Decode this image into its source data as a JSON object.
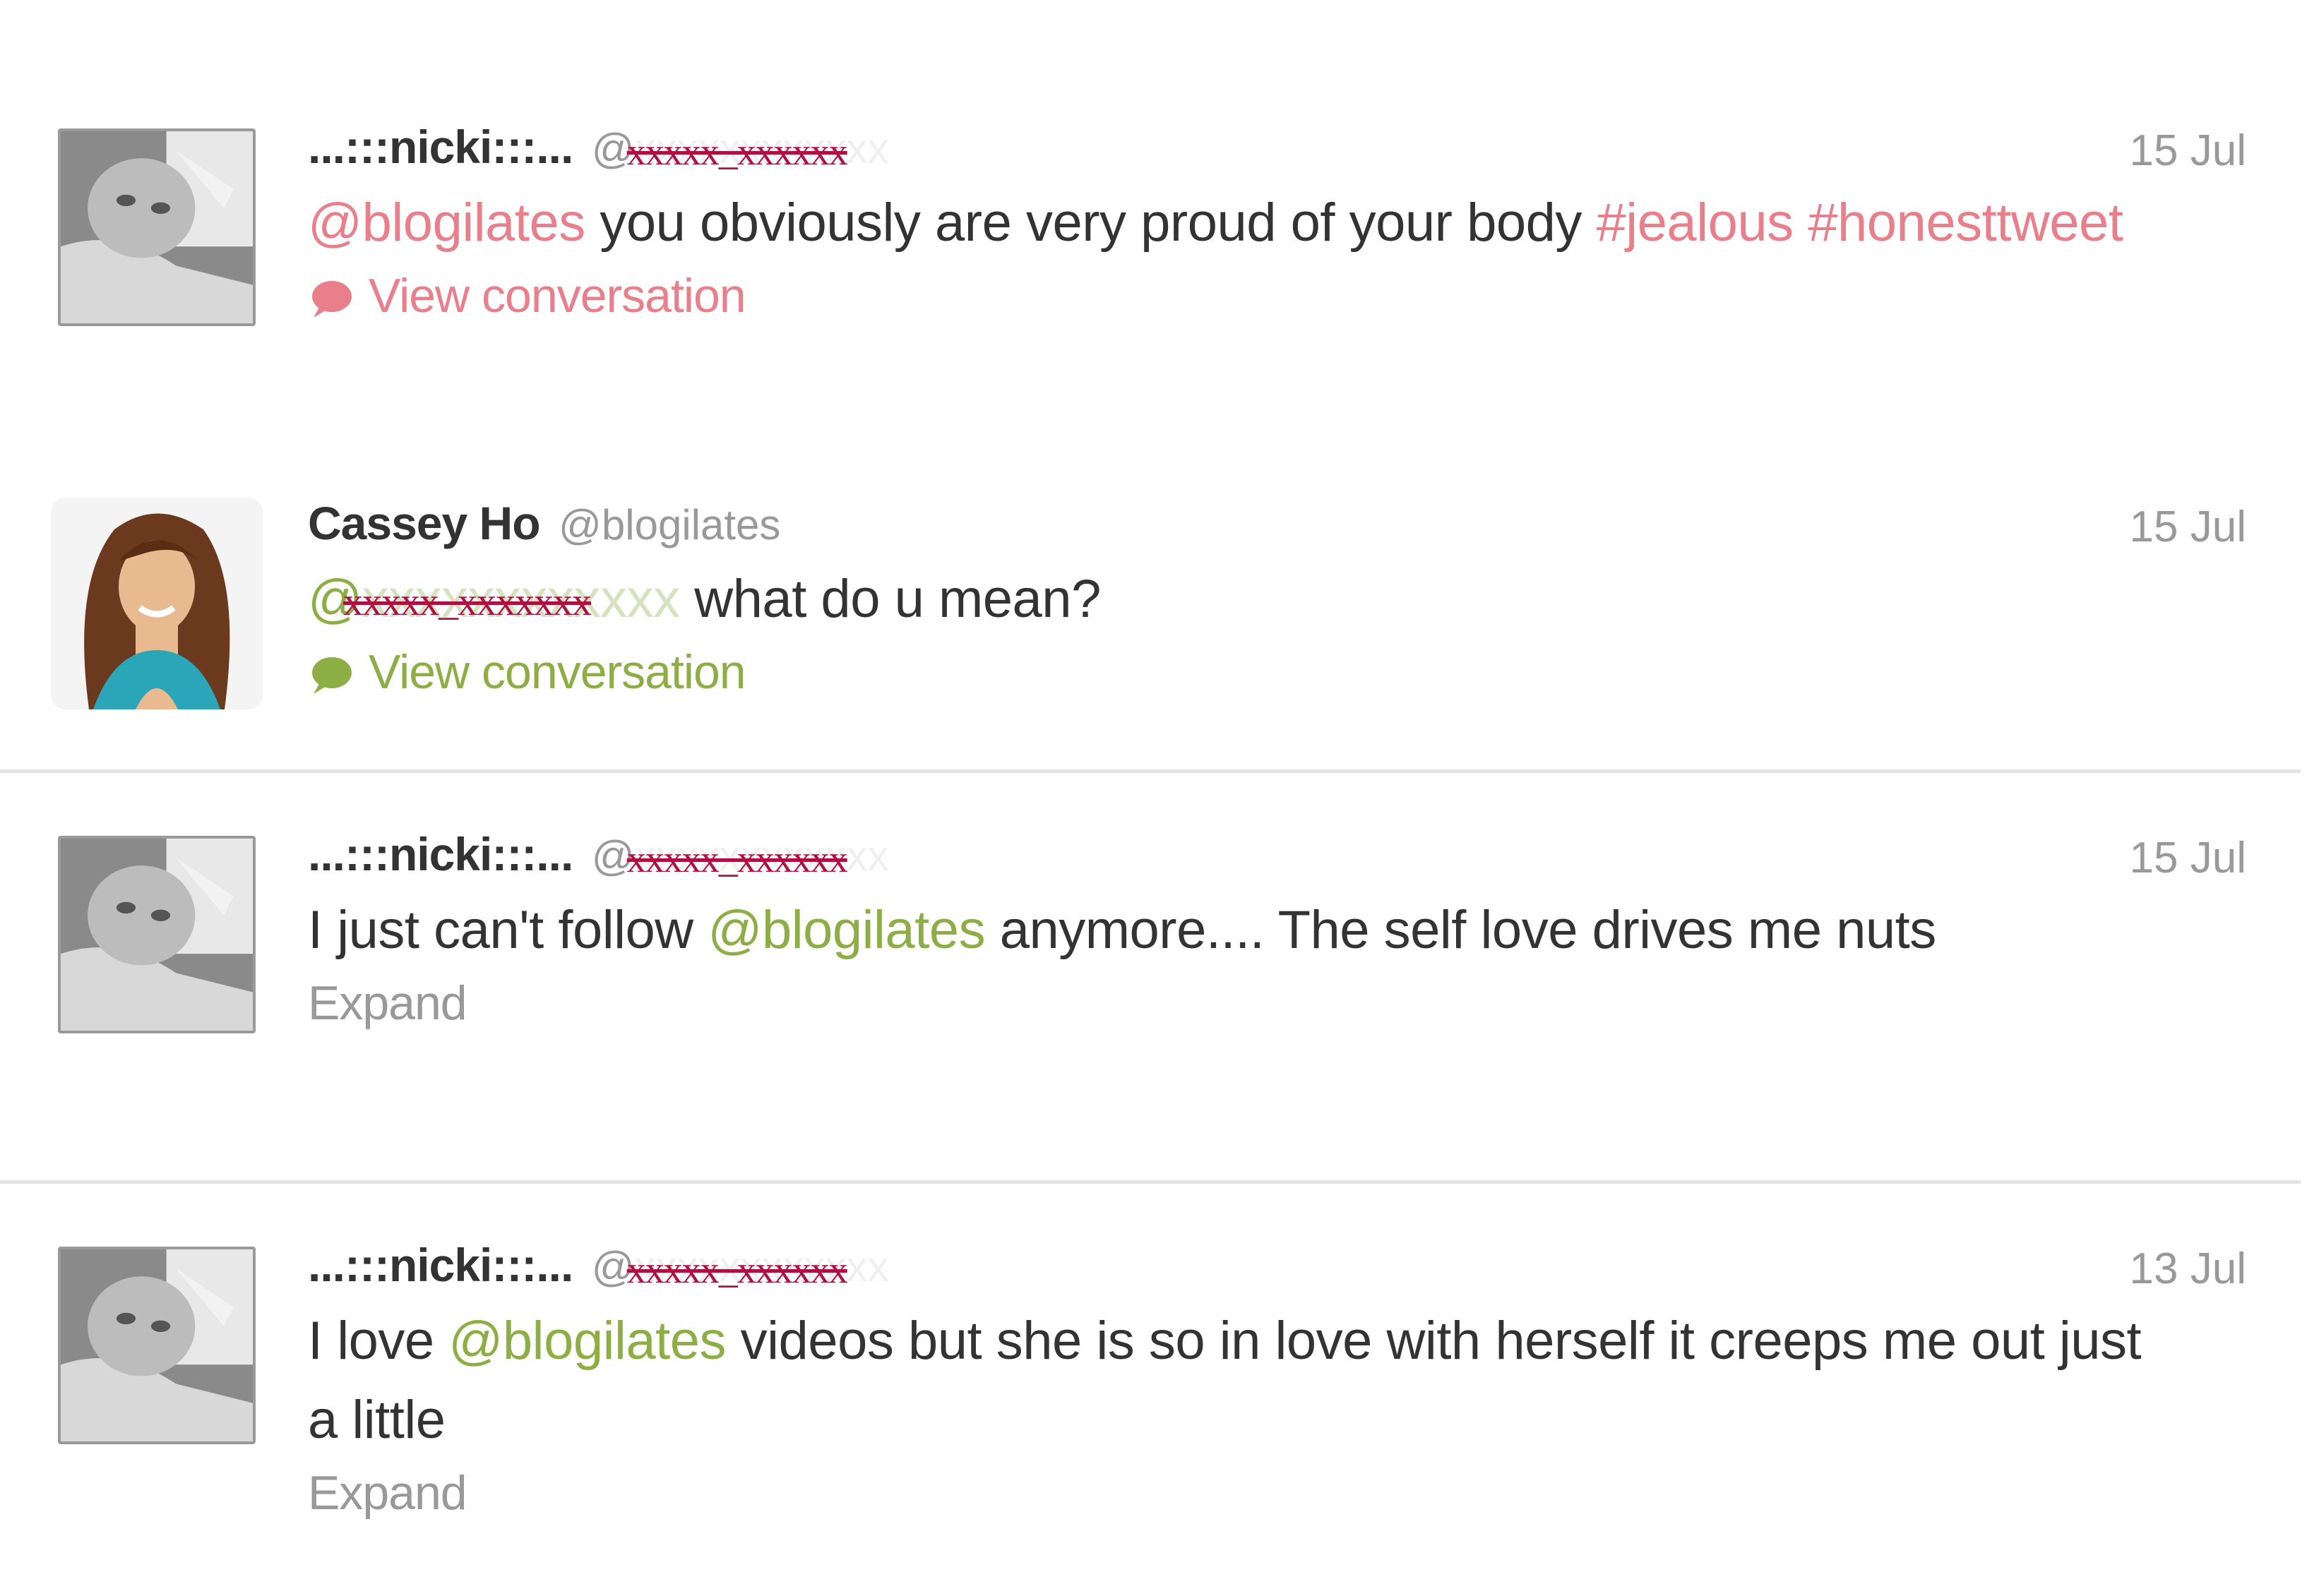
{
  "tweets": [
    {
      "name": "...:::nicki:::...",
      "handle_prefix": "@",
      "handle_redacted": "xxxxx_xxxxxx",
      "time": "15 Jul",
      "text": [
        {
          "t": "@blogilates",
          "kind": "link"
        },
        {
          "t": " you obviously are very proud of your body ",
          "kind": "plain"
        },
        {
          "t": "#jealous",
          "kind": "link"
        },
        {
          "t": " ",
          "kind": "plain"
        },
        {
          "t": "#honesttweet",
          "kind": "link"
        }
      ],
      "action": "View conversation"
    },
    {
      "name": "Cassey Ho",
      "handle": "@blogilates",
      "time": "15 Jul",
      "mention_prefix": "@",
      "mention_redacted": "xxxxx_xxxxxxx",
      "text_after": " what do u mean?",
      "action": "View conversation"
    },
    {
      "name": "...:::nicki:::...",
      "handle_prefix": "@",
      "handle_redacted": "xxxxx_xxxxxx",
      "time": "15 Jul",
      "text": [
        {
          "t": "I just can't follow ",
          "kind": "plain"
        },
        {
          "t": "@blogilates",
          "kind": "link"
        },
        {
          "t": " anymore.... The self love drives me nuts",
          "kind": "plain"
        }
      ],
      "action": "Expand"
    },
    {
      "name": "...:::nicki:::...",
      "handle_prefix": "@",
      "handle_redacted": "xxxxx_xxxxxx",
      "time": "13 Jul",
      "text": [
        {
          "t": "I love ",
          "kind": "plain"
        },
        {
          "t": "@blogilates",
          "kind": "link"
        },
        {
          "t": " videos but she is so in love with herself it creeps me out just a little",
          "kind": "plain"
        }
      ],
      "action": "Expand"
    }
  ],
  "colors": {
    "link_pink": "#e87f8a",
    "link_green": "#8cae44",
    "redaction": "#b01040",
    "meta_grey": "#999999",
    "divider": "#e3e3e3"
  },
  "icons": {
    "bubble": "speech-bubble-icon"
  }
}
